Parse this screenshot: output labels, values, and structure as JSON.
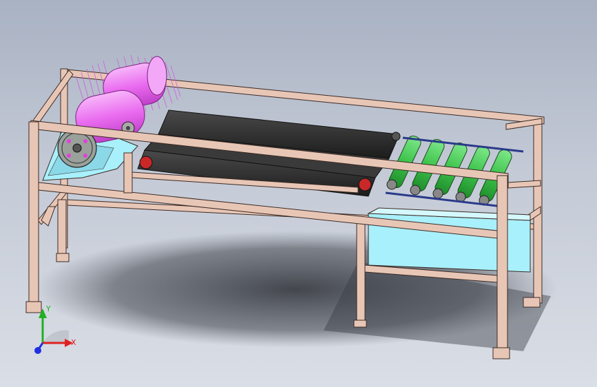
{
  "colors": {
    "frame_fill": "#e8c6b6",
    "frame_stroke": "#3a2a24",
    "belt": "#2b2b2b",
    "roller_green": "#3cc24a",
    "brush_magenta": "#ea6cf0",
    "hopper_cyan": "#a8f0fb",
    "axis_x": "#e02020",
    "axis_y": "#20b020",
    "axis_z": "#2030e0"
  },
  "icons": {
    "triad": "coordinate-triad-icon"
  },
  "triad": {
    "x_label": "X",
    "y_label": "Y"
  }
}
